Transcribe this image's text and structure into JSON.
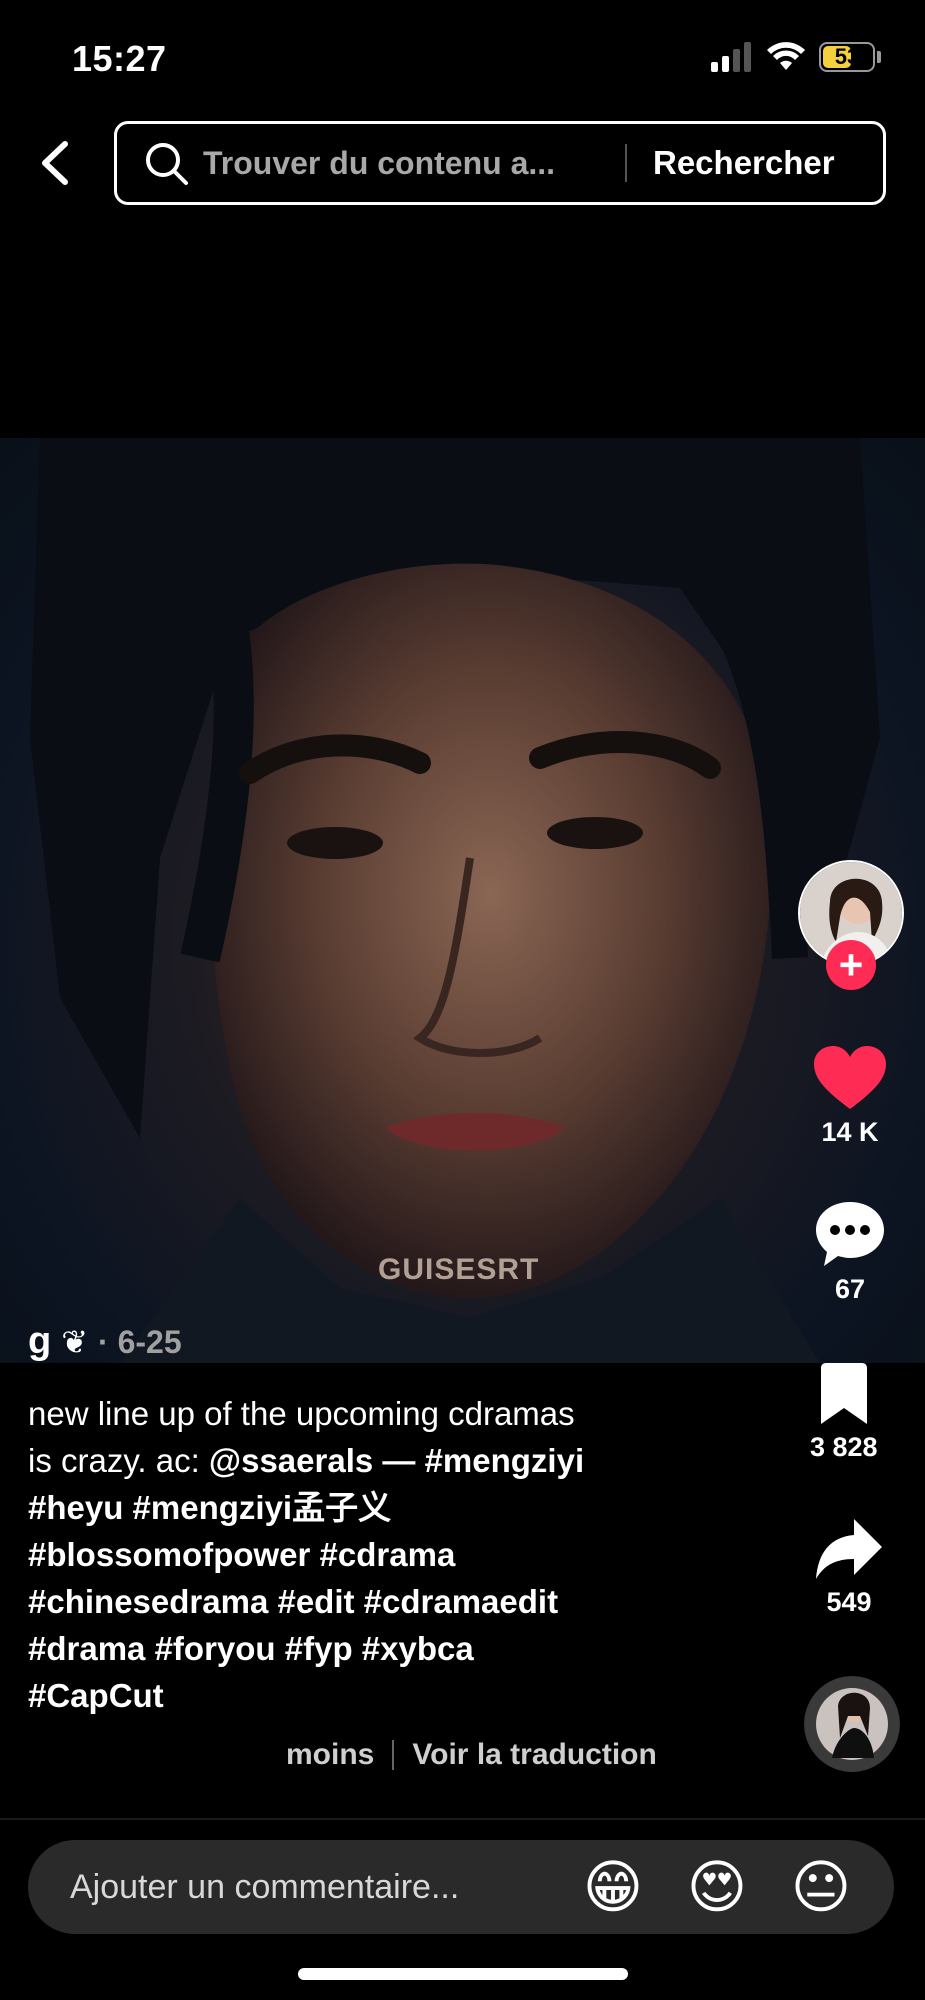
{
  "status_bar": {
    "time": "15:27",
    "battery": "53"
  },
  "search": {
    "placeholder": "Trouver du contenu a...",
    "submit_label": "Rechercher"
  },
  "video": {
    "watermark": "GUISESRT"
  },
  "author": {
    "name": "g",
    "emoji": "❦",
    "date": "· 6-25"
  },
  "caption": {
    "line1": "new line up of the upcoming cdramas",
    "line2_text": "is crazy. ac: ",
    "mention": "@ssaerals",
    "line2_rest": " — #mengziyi",
    "line3": "#heyu #mengziyi孟子义",
    "line4": "#blossomofpower #cdrama",
    "line5": "#chinesedrama #edit #cdramaedit",
    "line6": "#drama #foryou #fyp #xybca",
    "line7": "#CapCut",
    "less_label": "moins",
    "translate_label": "Voir la traduction"
  },
  "actions": {
    "likes": "14 K",
    "comments": "67",
    "saves": "3 828",
    "shares": "549",
    "follow_label": "+"
  },
  "comment_bar": {
    "placeholder": "Ajouter un commentaire...",
    "emojis": [
      "😁",
      "😍",
      "😐"
    ]
  },
  "colors": {
    "accent": "#fe2c55",
    "battery": "#f4d03f"
  }
}
